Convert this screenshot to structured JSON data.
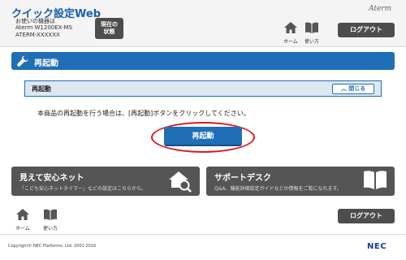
{
  "header": {
    "app_title": "クイック設定Web",
    "device_label": "お使いの機器は",
    "device_model": "Aterm W1200EX-MS",
    "device_id": "ATERM-XXXXXX",
    "status_button": "現在の状態",
    "brand": "Aterm",
    "home_label": "ホーム",
    "howto_label": "使い方",
    "logout_label": "ログアウト"
  },
  "section": {
    "title": "再起動"
  },
  "panel": {
    "title": "再起動",
    "close_label": "閉じる",
    "instruction": "本商品の再起動を行う場合は、[再起動]ボタンをクリックしてください。",
    "restart_button": "再起動"
  },
  "tiles": [
    {
      "title": "見えて安心ネット",
      "desc": "「こども安心ネットタイマー」などの設定はこちらから。",
      "icon": "house-search-icon"
    },
    {
      "title": "サポートデスク",
      "desc": "Q&A、機能詳細設定ガイドなどの情報をご覧になれます。",
      "icon": "book-icon"
    }
  ],
  "footer": {
    "home_label": "ホーム",
    "howto_label": "使い方",
    "logout_label": "ログアウト",
    "copyright": "Copyright© NEC Platforms, Ltd. 2001-2016",
    "logo": "NEC"
  },
  "colors": {
    "accent": "#1f6fb7",
    "dark_button": "#4d4d4d",
    "highlight_ring": "#e0161b"
  }
}
